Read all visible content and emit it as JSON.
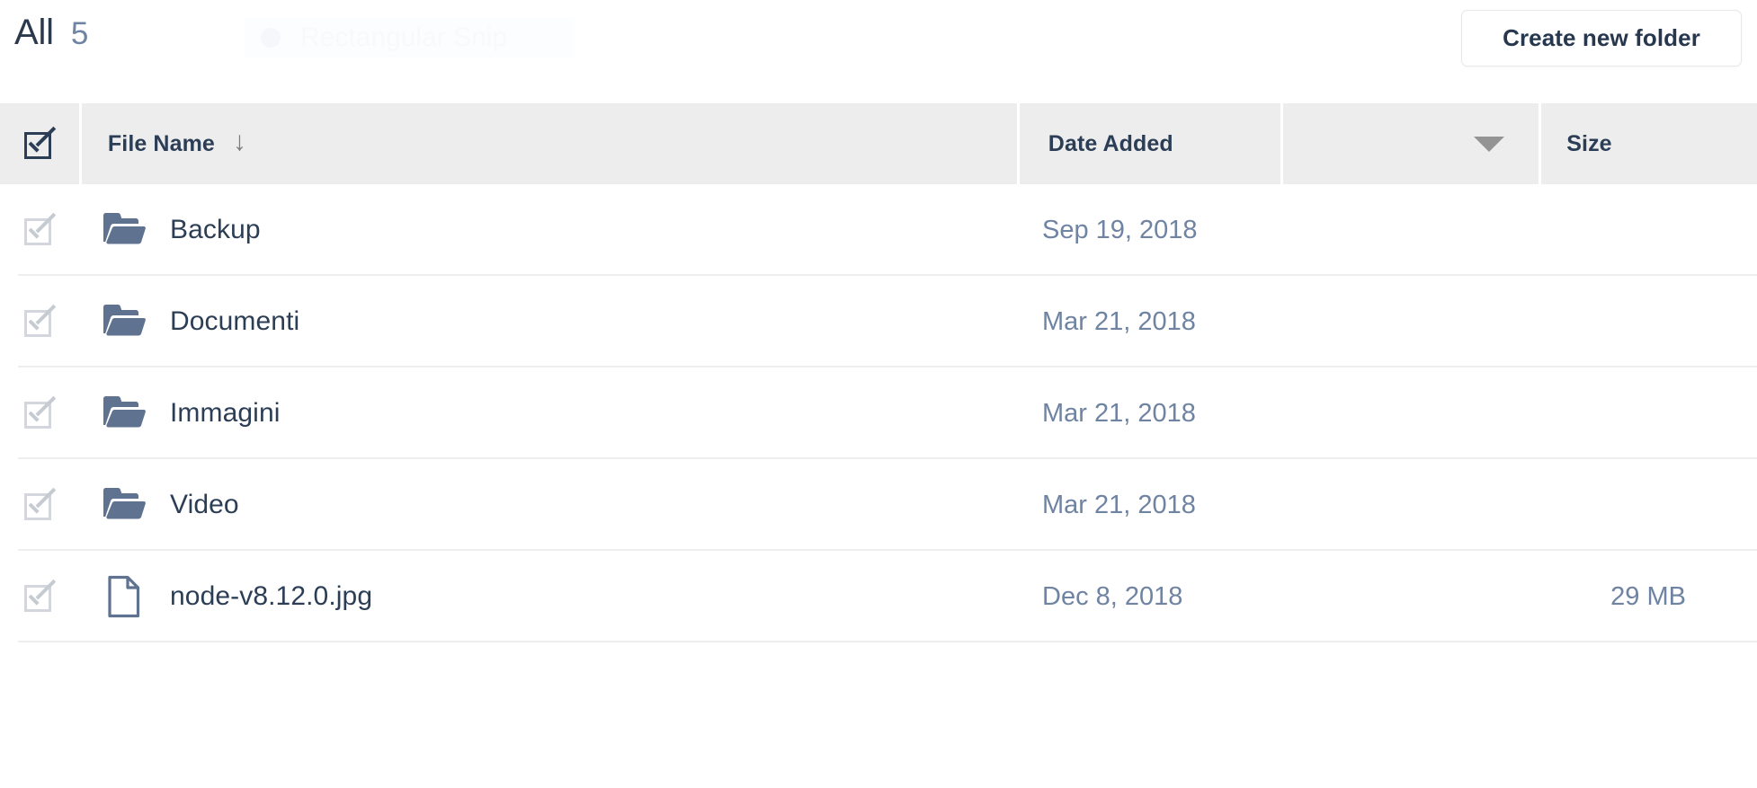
{
  "header": {
    "title": "All",
    "count": "5",
    "create_folder_label": "Create new folder"
  },
  "toast": {
    "label": "Rectangular Snip",
    "icon": "circle-icon"
  },
  "table": {
    "columns": {
      "select_all": "select-all-checkbox",
      "file_name": "File Name",
      "date_added": "Date Added",
      "size": "Size"
    },
    "sort": {
      "file_name_indicator": "↓",
      "date_added_indicator": "caret-down-icon"
    },
    "rows": [
      {
        "icon": "folder-icon",
        "name": "Backup",
        "date": "Sep 19, 2018",
        "size": ""
      },
      {
        "icon": "folder-icon",
        "name": "Documenti",
        "date": "Mar 21, 2018",
        "size": ""
      },
      {
        "icon": "folder-icon",
        "name": "Immagini",
        "date": "Mar 21, 2018",
        "size": ""
      },
      {
        "icon": "folder-icon",
        "name": "Video",
        "date": "Mar 21, 2018",
        "size": ""
      },
      {
        "icon": "file-icon",
        "name": "node-v8.12.0.jpg",
        "date": "Dec 8, 2018",
        "size": "29 MB"
      }
    ]
  },
  "colors": {
    "text_dark": "#2c3e55",
    "text_muted": "#6f83a2",
    "icon_blue": "#5f7390",
    "header_bg": "#ededed",
    "row_divider": "#eeeeee"
  }
}
